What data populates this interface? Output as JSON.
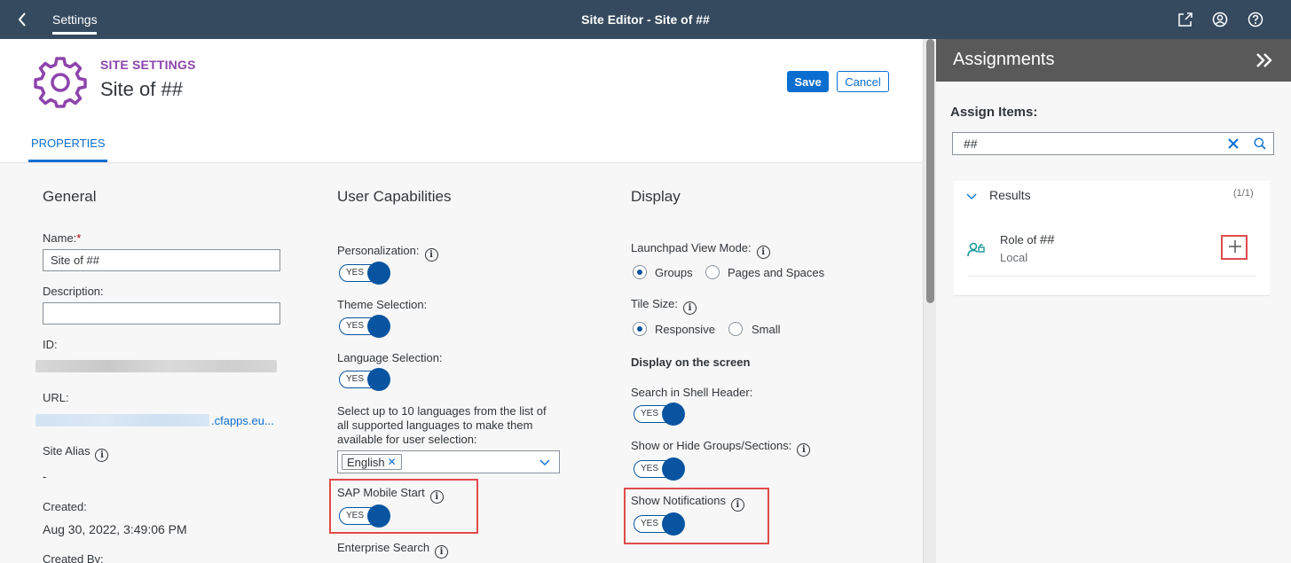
{
  "shell": {
    "back_icon": "back-arrow-icon",
    "tab_label": "Settings",
    "title": "Site Editor - Site of ##",
    "icons": [
      "share-icon",
      "user-profile-icon",
      "help-icon"
    ]
  },
  "header": {
    "subtitle": "SITE SETTINGS",
    "title": "Site of ##",
    "save_label": "Save",
    "cancel_label": "Cancel",
    "tab_properties": "PROPERTIES",
    "accent_color": "#8e44ad",
    "primary_color": "#0a6ed1"
  },
  "general": {
    "title": "General",
    "name_label": "Name:",
    "name_required": "*",
    "name_value": "Site of ##",
    "description_label": "Description:",
    "description_value": "",
    "id_label": "ID:",
    "url_label": "URL:",
    "url_visible_suffix": ".cfapps.eu...",
    "site_alias_label": "Site Alias",
    "site_alias_value": "-",
    "created_label": "Created:",
    "created_value": "Aug 30, 2022, 3:49:06 PM",
    "created_by_label": "Created By:"
  },
  "user_capabilities": {
    "title": "User Capabilities",
    "personalization_label": "Personalization:",
    "theme_label": "Theme Selection:",
    "language_label": "Language Selection:",
    "languages_hint": "Select up to 10 languages from the list of all supported languages to make them available for user selection:",
    "language_token": "English",
    "mobile_start_label": "SAP Mobile Start",
    "enterprise_search_label": "Enterprise Search",
    "toggle_text": "YES"
  },
  "display": {
    "title": "Display",
    "view_mode_label": "Launchpad View Mode:",
    "view_mode_options": [
      "Groups",
      "Pages and Spaces"
    ],
    "view_mode_selected": "Groups",
    "tile_size_label": "Tile Size:",
    "tile_size_options": [
      "Responsive",
      "Small"
    ],
    "tile_size_selected": "Responsive",
    "on_screen_label": "Display on the screen",
    "search_shell_label": "Search in Shell Header:",
    "groups_sections_label": "Show or Hide Groups/Sections:",
    "notifications_label": "Show Notifications",
    "toggle_text": "YES"
  },
  "assignments": {
    "title": "Assignments",
    "collapse_icon": "double-chevron-right-icon",
    "assign_label": "Assign Items:",
    "search_value": "##",
    "results_label": "Results",
    "results_count": "(1/1)",
    "item_name_prefix": "Role of ",
    "item_name_hash": "##",
    "item_sub": "Local",
    "item_icon": "role-icon",
    "add_icon": "add-icon"
  },
  "highlight_color": "#e04b4b"
}
